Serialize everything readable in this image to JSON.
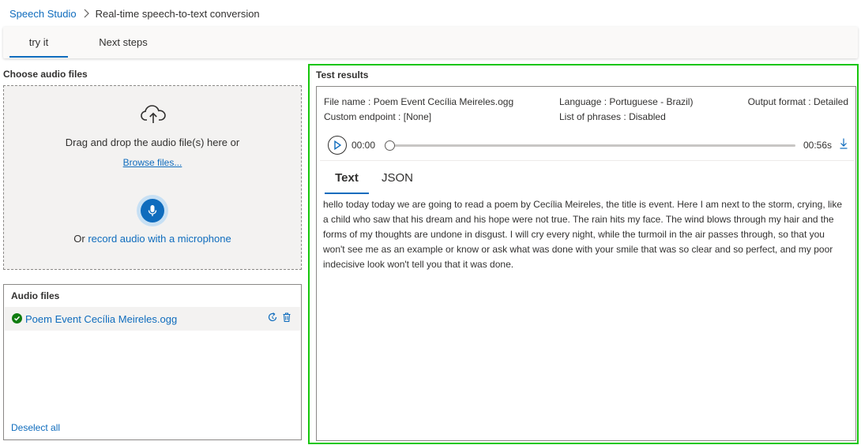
{
  "breadcrumb": {
    "root": "Speech Studio",
    "current": "Real-time speech-to-text conversion"
  },
  "tabs": [
    {
      "label": "try it",
      "selected": true
    },
    {
      "label": "Next steps",
      "selected": false
    }
  ],
  "upload": {
    "title": "Choose audio files",
    "drag_text": "Drag and drop the audio file(s) here or",
    "browse_label": "Browse files...",
    "record_prefix": "Or",
    "record_link": "record audio with a microphone"
  },
  "audio_files": {
    "title": "Audio files",
    "files": [
      {
        "name": "Poem Event Cecília Meireles.ogg",
        "status": "success"
      }
    ],
    "deselect_label": "Deselect all"
  },
  "results": {
    "title": "Test results",
    "file_name_label": "File name :",
    "file_name_value": "Poem Event Cecília Meireles.ogg",
    "custom_endpoint_label": "Custom endpoint :",
    "custom_endpoint_value": "[None]",
    "language_label": "Language :",
    "language_value": "Portuguese - Brazil)",
    "phrases_label": "List of phrases :",
    "phrases_value": "Disabled",
    "output_format_label": "Output format :",
    "output_format_value": "Detailed",
    "player": {
      "current_time": "00:00",
      "duration": "00:56s",
      "progress": 0
    },
    "view_tabs": [
      {
        "label": "Text",
        "selected": true
      },
      {
        "label": "JSON",
        "selected": false
      }
    ],
    "transcript": "hello today today we are going to read a poem by Cecília Meireles, the title is event. Here I am next to the storm, crying, like a child who saw that his dream and his hope were not true. The rain hits my face. The wind blows through my hair and the forms of my thoughts are undone in disgust. I will cry every night, while the turmoil in the air passes through, so that you won't see me as an example or know or ask what was done with your smile that was so clear and so perfect, and my poor indecisive look won't tell you that it was done."
  },
  "colors": {
    "accent": "#0f6cbd",
    "highlight_border": "#16c60c",
    "success": "#107c10"
  }
}
